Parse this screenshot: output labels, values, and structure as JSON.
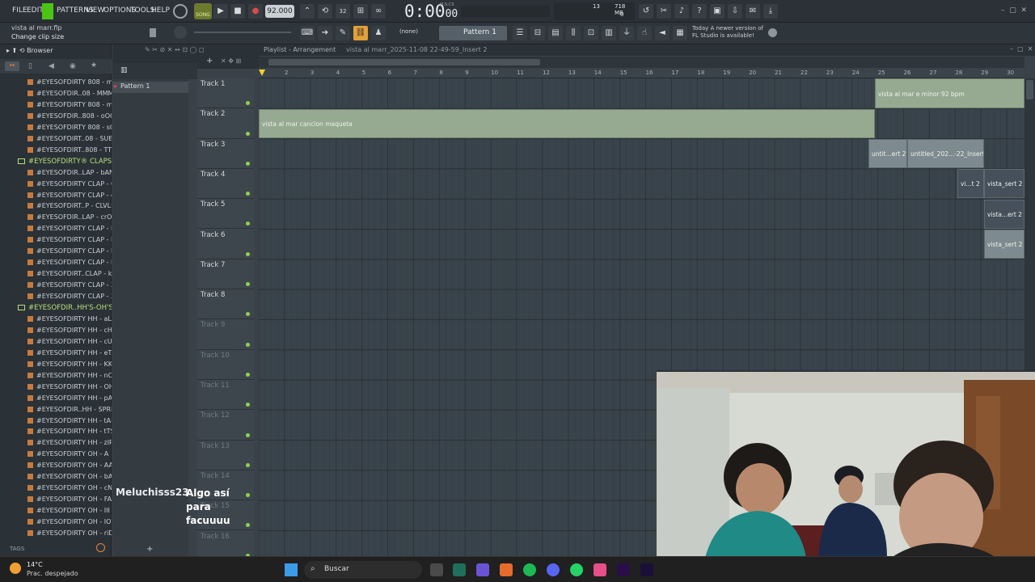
{
  "menu": [
    "FILE",
    "EDIT",
    "PATTERNS",
    "VIEW",
    "OPTIONS",
    "TOOLS",
    "HELP"
  ],
  "transport": {
    "song_badge": "SONG",
    "tempo": "92.000",
    "time": "0:00",
    "time_sub": "00",
    "time_unit": "M:S:CS"
  },
  "status": {
    "file": "vista al marr.flp",
    "hint": "Change clip size"
  },
  "cpu": {
    "value": "13",
    "memory": "718 MB",
    "zero": "0"
  },
  "news": {
    "line1": "Today  A newer version of",
    "line2": "FL Studio is available!"
  },
  "snap": "(none)",
  "pattern_select": "Pattern 1",
  "browser": {
    "title": "Browser",
    "tags_label": "TAGS",
    "items": [
      {
        "type": "file",
        "label": "#EYESOFDIRTY 808 - mINI"
      },
      {
        "type": "file",
        "label": "#EYESOFDIR..08 - MMMM"
      },
      {
        "type": "file",
        "label": "#EYESOFDIRTY 808 - mTR"
      },
      {
        "type": "file",
        "label": "#EYESOFDIR..808 - oOOO"
      },
      {
        "type": "file",
        "label": "#EYESOFDIRTY 808 - sOFT"
      },
      {
        "type": "file",
        "label": "#EYESOFDIRT..08 - SUBUc"
      },
      {
        "type": "file",
        "label": "#EYESOFDIRT..808 - TTTTT"
      },
      {
        "type": "folder",
        "label": "#EYESOFDIRTY® CLAPS"
      },
      {
        "type": "file",
        "label": "#EYESOFDIR..LAP - bANDS"
      },
      {
        "type": "file",
        "label": "#EYESOFDIRTY CLAP - CCC"
      },
      {
        "type": "file",
        "label": "#EYESOFDIRTY CLAP - cLN"
      },
      {
        "type": "file",
        "label": "#EYESOFDIRT..P - CLVLNd"
      },
      {
        "type": "file",
        "label": "#EYESOFDIR..LAP - crOWD"
      },
      {
        "type": "file",
        "label": "#EYESOFDIRTY CLAP - EVA"
      },
      {
        "type": "file",
        "label": "#EYESOFDIRTY CLAP - I"
      },
      {
        "type": "file",
        "label": "#EYESOFDIRTY CLAP - II"
      },
      {
        "type": "file",
        "label": "#EYESOFDIRTY CLAP - III"
      },
      {
        "type": "file",
        "label": "#EYESOFDIRT..CLAP - kKU"
      },
      {
        "type": "file",
        "label": "#EYESOFDIRTY CLAP - Xr"
      },
      {
        "type": "file",
        "label": "#EYESOFDIRTY CLAP - XXX"
      },
      {
        "type": "folder",
        "label": "#EYESOFDIR..HH'S-OH'S"
      },
      {
        "type": "file",
        "label": "#EYESOFDIRTY HH - aLM"
      },
      {
        "type": "file",
        "label": "#EYESOFDIRTY HH - cHE"
      },
      {
        "type": "file",
        "label": "#EYESOFDIRTY HH - cUT"
      },
      {
        "type": "file",
        "label": "#EYESOFDIRTY HH - eTA"
      },
      {
        "type": "file",
        "label": "#EYESOFDIRTY HH - KK"
      },
      {
        "type": "file",
        "label": "#EYESOFDIRTY HH - nOS"
      },
      {
        "type": "file",
        "label": "#EYESOFDIRTY HH - OHm"
      },
      {
        "type": "file",
        "label": "#EYESOFDIRTY HH - pArt"
      },
      {
        "type": "file",
        "label": "#EYESOFDIR..HH - SPRNo"
      },
      {
        "type": "file",
        "label": "#EYESOFDIRTY HH - tAP"
      },
      {
        "type": "file",
        "label": "#EYESOFDIRTY HH - tTS"
      },
      {
        "type": "file",
        "label": "#EYESOFDIRTY HH - zIP"
      },
      {
        "type": "file",
        "label": "#EYESOFDIRTY OH - A"
      },
      {
        "type": "file",
        "label": "#EYESOFDIRTY OH - AAA"
      },
      {
        "type": "file",
        "label": "#EYESOFDIRTY OH - bAR"
      },
      {
        "type": "file",
        "label": "#EYESOFDIRTY OH - cNZX"
      },
      {
        "type": "file",
        "label": "#EYESOFDIRTY OH - FAH"
      },
      {
        "type": "file",
        "label": "#EYESOFDIRTY OH - III"
      },
      {
        "type": "file",
        "label": "#EYESOFDIRTY OH - IOW"
      },
      {
        "type": "file",
        "label": "#EYESOFDIRTY OH - riDE"
      }
    ]
  },
  "playlist": {
    "title": "Playlist - Arrangement",
    "project": "vista al marr_2025-11-08 22-49-59_Insert 2",
    "pattern_list": [
      "Pattern 1"
    ],
    "ruler": [
      "2",
      "3",
      "4",
      "5",
      "6",
      "7",
      "8",
      "9",
      "10",
      "11",
      "12",
      "13",
      "14",
      "15",
      "16",
      "17",
      "18",
      "19",
      "20",
      "21",
      "22",
      "23",
      "24",
      "25",
      "26",
      "27",
      "28",
      "29",
      "30"
    ],
    "tracks": [
      "Track 1",
      "Track 2",
      "Track 3",
      "Track 4",
      "Track 5",
      "Track 6",
      "Track 7",
      "Track 8",
      "Track 9",
      "Track 10",
      "Track 11",
      "Track 12",
      "Track 13",
      "Track 14",
      "Track 15",
      "Track 16"
    ],
    "clips": {
      "c1": "vista al mar e minor 92 bpm",
      "c2": "vista al mar cancion maqueta",
      "c3a": "untit...ert 2",
      "c3b": "untitled_202...-22_Insert 2",
      "c4a": "vi...t 2",
      "c4b": "vista_sert 2",
      "c5": "vista...ert 2",
      "c6": "vista_sert 2"
    }
  },
  "chat": {
    "user": "Meluchisss23",
    "message": "Algo así para facuuuu"
  },
  "taskbar": {
    "weather_temp": "14°C",
    "weather_desc": "Prac. despejado",
    "search": "Buscar"
  }
}
